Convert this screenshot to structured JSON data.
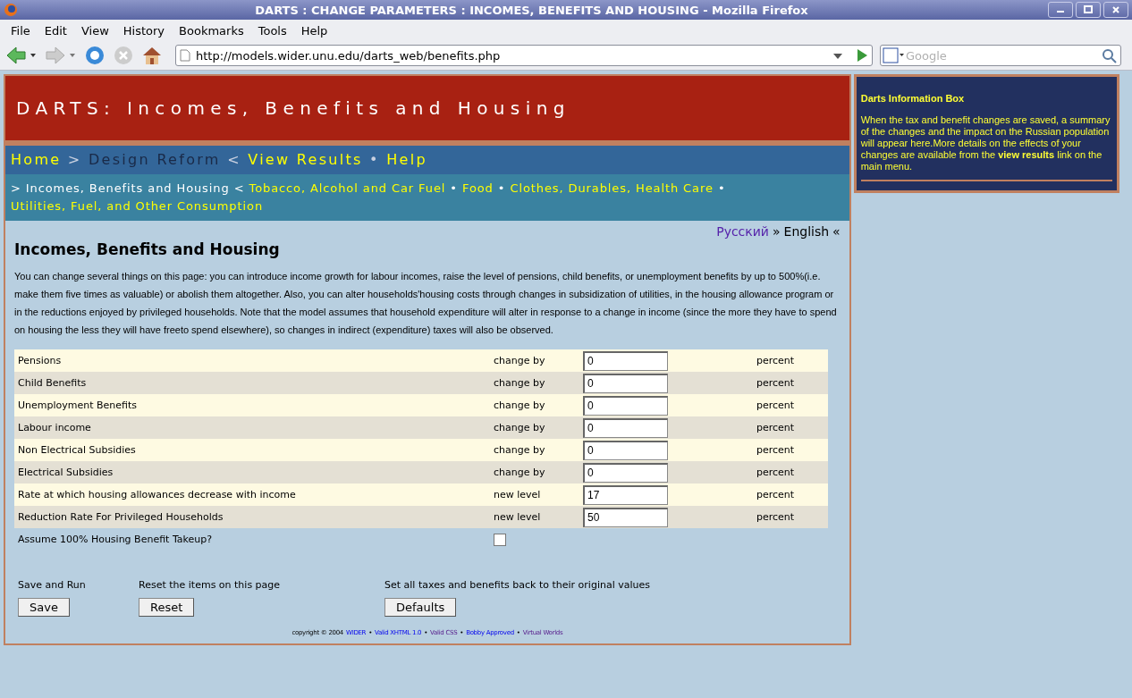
{
  "window": {
    "title": "DARTS : CHANGE PARAMETERS : INCOMES, BENEFITS AND HOUSING - Mozilla Firefox"
  },
  "menu": [
    "File",
    "Edit",
    "View",
    "History",
    "Bookmarks",
    "Tools",
    "Help"
  ],
  "toolbar": {
    "url": "http://models.wider.unu.edu/darts_web/benefits.php",
    "search_placeholder": "Google"
  },
  "header": {
    "title": "DARTS: Incomes, Benefits and Housing"
  },
  "nav": [
    {
      "text": "Home",
      "kind": "link"
    },
    {
      "text": ">",
      "kind": "sep"
    },
    {
      "text": "Design Reform",
      "kind": "current"
    },
    {
      "text": "<",
      "kind": "sep"
    },
    {
      "text": "View Results",
      "kind": "link"
    },
    {
      "text": "•",
      "kind": "sep"
    },
    {
      "text": "Help",
      "kind": "link"
    }
  ],
  "subnav": [
    {
      "text": ">",
      "kind": "sep"
    },
    {
      "text": "Incomes, Benefits and Housing",
      "kind": "current"
    },
    {
      "text": "<",
      "kind": "sep"
    },
    {
      "text": "Tobacco, Alcohol and Car Fuel",
      "kind": "link"
    },
    {
      "text": "•",
      "kind": "sep"
    },
    {
      "text": "Food",
      "kind": "link"
    },
    {
      "text": "•",
      "kind": "sep"
    },
    {
      "text": "Clothes, Durables, Health Care",
      "kind": "link"
    },
    {
      "text": "•",
      "kind": "sep"
    },
    {
      "text": "Utilities, Fuel, and",
      "kind": "link"
    },
    {
      "text": "Other Consumption",
      "kind": "link"
    }
  ],
  "languages": [
    {
      "text": "Русский",
      "kind": "link"
    },
    {
      "text": "»",
      "kind": "sep"
    },
    {
      "text": "English",
      "kind": "current"
    },
    {
      "text": "«",
      "kind": "sep"
    }
  ],
  "heading": "Incomes, Benefits and Housing",
  "intro": "You can change several things on this page: you can introduce income growth for labour incomes, raise the level of pensions, child benefits, or unemployment benefits by up to 500%(i.e. make them five times as valuable) or abolish them altogether. Also, you can alter households'housing costs through changes in subsidization of utilities, in the housing allowance program or in the reductions enjoyed by privileged households. Note that the model assumes that household expenditure will alter in response to a change in income (since the more they have to spend on housing the less they will have freeto spend elsewhere), so changes in indirect (expenditure) taxes will also be observed.",
  "parameters": [
    {
      "label": "Pensions",
      "action": "change by",
      "value": "0",
      "unit": "percent"
    },
    {
      "label": "Child Benefits",
      "action": "change by",
      "value": "0",
      "unit": "percent"
    },
    {
      "label": "Unemployment Benefits",
      "action": "change by",
      "value": "0",
      "unit": "percent"
    },
    {
      "label": "Labour income",
      "action": "change by",
      "value": "0",
      "unit": "percent"
    },
    {
      "label": "Non Electrical Subsidies",
      "action": "change by",
      "value": "0",
      "unit": "percent"
    },
    {
      "label": "Electrical Subsidies",
      "action": "change by",
      "value": "0",
      "unit": "percent"
    },
    {
      "label": "Rate at which housing allowances decrease with income",
      "action": "new level",
      "value": "17",
      "unit": "percent"
    },
    {
      "label": "Reduction Rate For Privileged Households",
      "action": "new level",
      "value": "50",
      "unit": "percent"
    }
  ],
  "takeup": {
    "label": "Assume 100% Housing Benefit Takeup?",
    "checked": false
  },
  "actions": [
    {
      "caption": "Save and Run",
      "button": "Save"
    },
    {
      "caption": "Reset the items on this page",
      "button": "Reset"
    },
    {
      "caption": "Set all taxes and benefits back to their original values",
      "button": "Defaults"
    }
  ],
  "footer": {
    "copyright": "copyright © 2004",
    "items": [
      {
        "text": "WIDER",
        "kind": "link",
        "visited": false
      },
      {
        "text": "•",
        "kind": "sep"
      },
      {
        "text": "Valid XHTML 1.0",
        "kind": "link",
        "visited": false
      },
      {
        "text": "•",
        "kind": "sep"
      },
      {
        "text": "Valid CSS",
        "kind": "link",
        "visited": true
      },
      {
        "text": "•",
        "kind": "sep"
      },
      {
        "text": "Bobby Approved",
        "kind": "link",
        "visited": false
      },
      {
        "text": "•",
        "kind": "sep"
      },
      {
        "text": "Virtual Worlds",
        "kind": "link",
        "visited": true
      }
    ]
  },
  "info_box": {
    "title": "Darts Information Box",
    "text": "When the tax and benefit changes are saved, a summary of the changes and the impact on the Russian population will appear here.More details on the effects of your changes are available from the **view results** link on the main menu."
  }
}
